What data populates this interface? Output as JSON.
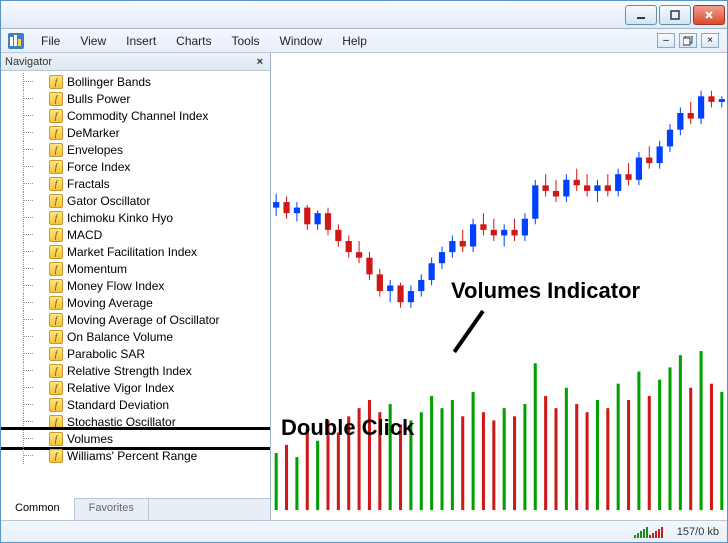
{
  "menubar": {
    "items": [
      "File",
      "View",
      "Insert",
      "Charts",
      "Tools",
      "Window",
      "Help"
    ]
  },
  "navigator": {
    "title": "Navigator",
    "indicators": [
      "Bollinger Bands",
      "Bulls Power",
      "Commodity Channel Index",
      "DeMarker",
      "Envelopes",
      "Force Index",
      "Fractals",
      "Gator Oscillator",
      "Ichimoku Kinko Hyo",
      "MACD",
      "Market Facilitation Index",
      "Momentum",
      "Money Flow Index",
      "Moving Average",
      "Moving Average of Oscillator",
      "On Balance Volume",
      "Parabolic SAR",
      "Relative Strength Index",
      "Relative Vigor Index",
      "Standard Deviation",
      "Stochastic Oscillator",
      "Volumes",
      "Williams' Percent Range"
    ],
    "highlighted_index": 21,
    "tabs": {
      "common": "Common",
      "favorites": "Favorites",
      "active": "common"
    }
  },
  "annotations": {
    "volumes_label": "Volumes Indicator",
    "double_click": "Double Click"
  },
  "statusbar": {
    "traffic": "157/0 kb"
  },
  "chart_data": {
    "type": "candlestick+volume",
    "price_ylim": [
      0,
      100
    ],
    "candles": [
      {
        "o": 48,
        "h": 53,
        "l": 45,
        "c": 50,
        "col": "up"
      },
      {
        "o": 50,
        "h": 52,
        "l": 44,
        "c": 46,
        "col": "down"
      },
      {
        "o": 46,
        "h": 50,
        "l": 43,
        "c": 48,
        "col": "up"
      },
      {
        "o": 48,
        "h": 49,
        "l": 40,
        "c": 42,
        "col": "down"
      },
      {
        "o": 42,
        "h": 47,
        "l": 40,
        "c": 46,
        "col": "up"
      },
      {
        "o": 46,
        "h": 48,
        "l": 38,
        "c": 40,
        "col": "down"
      },
      {
        "o": 40,
        "h": 42,
        "l": 34,
        "c": 36,
        "col": "down"
      },
      {
        "o": 36,
        "h": 38,
        "l": 30,
        "c": 32,
        "col": "down"
      },
      {
        "o": 32,
        "h": 36,
        "l": 28,
        "c": 30,
        "col": "down"
      },
      {
        "o": 30,
        "h": 32,
        "l": 22,
        "c": 24,
        "col": "down"
      },
      {
        "o": 24,
        "h": 26,
        "l": 16,
        "c": 18,
        "col": "down"
      },
      {
        "o": 18,
        "h": 22,
        "l": 14,
        "c": 20,
        "col": "up"
      },
      {
        "o": 20,
        "h": 21,
        "l": 12,
        "c": 14,
        "col": "down"
      },
      {
        "o": 14,
        "h": 20,
        "l": 12,
        "c": 18,
        "col": "up"
      },
      {
        "o": 18,
        "h": 24,
        "l": 16,
        "c": 22,
        "col": "up"
      },
      {
        "o": 22,
        "h": 30,
        "l": 20,
        "c": 28,
        "col": "up"
      },
      {
        "o": 28,
        "h": 34,
        "l": 26,
        "c": 32,
        "col": "up"
      },
      {
        "o": 32,
        "h": 38,
        "l": 30,
        "c": 36,
        "col": "up"
      },
      {
        "o": 36,
        "h": 40,
        "l": 32,
        "c": 34,
        "col": "down"
      },
      {
        "o": 34,
        "h": 44,
        "l": 32,
        "c": 42,
        "col": "up"
      },
      {
        "o": 42,
        "h": 46,
        "l": 38,
        "c": 40,
        "col": "down"
      },
      {
        "o": 40,
        "h": 44,
        "l": 36,
        "c": 38,
        "col": "down"
      },
      {
        "o": 38,
        "h": 42,
        "l": 34,
        "c": 40,
        "col": "up"
      },
      {
        "o": 40,
        "h": 44,
        "l": 36,
        "c": 38,
        "col": "down"
      },
      {
        "o": 38,
        "h": 46,
        "l": 36,
        "c": 44,
        "col": "up"
      },
      {
        "o": 44,
        "h": 58,
        "l": 42,
        "c": 56,
        "col": "up"
      },
      {
        "o": 56,
        "h": 60,
        "l": 52,
        "c": 54,
        "col": "down"
      },
      {
        "o": 54,
        "h": 58,
        "l": 50,
        "c": 52,
        "col": "down"
      },
      {
        "o": 52,
        "h": 60,
        "l": 50,
        "c": 58,
        "col": "up"
      },
      {
        "o": 58,
        "h": 62,
        "l": 54,
        "c": 56,
        "col": "down"
      },
      {
        "o": 56,
        "h": 60,
        "l": 52,
        "c": 54,
        "col": "down"
      },
      {
        "o": 54,
        "h": 58,
        "l": 50,
        "c": 56,
        "col": "up"
      },
      {
        "o": 56,
        "h": 60,
        "l": 52,
        "c": 54,
        "col": "down"
      },
      {
        "o": 54,
        "h": 62,
        "l": 52,
        "c": 60,
        "col": "up"
      },
      {
        "o": 60,
        "h": 64,
        "l": 56,
        "c": 58,
        "col": "down"
      },
      {
        "o": 58,
        "h": 68,
        "l": 56,
        "c": 66,
        "col": "up"
      },
      {
        "o": 66,
        "h": 70,
        "l": 62,
        "c": 64,
        "col": "down"
      },
      {
        "o": 64,
        "h": 72,
        "l": 62,
        "c": 70,
        "col": "up"
      },
      {
        "o": 70,
        "h": 78,
        "l": 68,
        "c": 76,
        "col": "up"
      },
      {
        "o": 76,
        "h": 84,
        "l": 74,
        "c": 82,
        "col": "up"
      },
      {
        "o": 82,
        "h": 86,
        "l": 78,
        "c": 80,
        "col": "down"
      },
      {
        "o": 80,
        "h": 90,
        "l": 78,
        "c": 88,
        "col": "up"
      },
      {
        "o": 88,
        "h": 90,
        "l": 84,
        "c": 86,
        "col": "down"
      },
      {
        "o": 86,
        "h": 88,
        "l": 84,
        "c": 87,
        "col": "up"
      }
    ],
    "volumes": [
      28,
      32,
      26,
      40,
      34,
      44,
      38,
      46,
      50,
      54,
      48,
      52,
      42,
      44,
      48,
      56,
      50,
      54,
      46,
      58,
      48,
      44,
      50,
      46,
      52,
      72,
      56,
      50,
      60,
      52,
      48,
      54,
      50,
      62,
      54,
      68,
      56,
      64,
      70,
      76,
      60,
      78,
      62,
      58
    ]
  }
}
